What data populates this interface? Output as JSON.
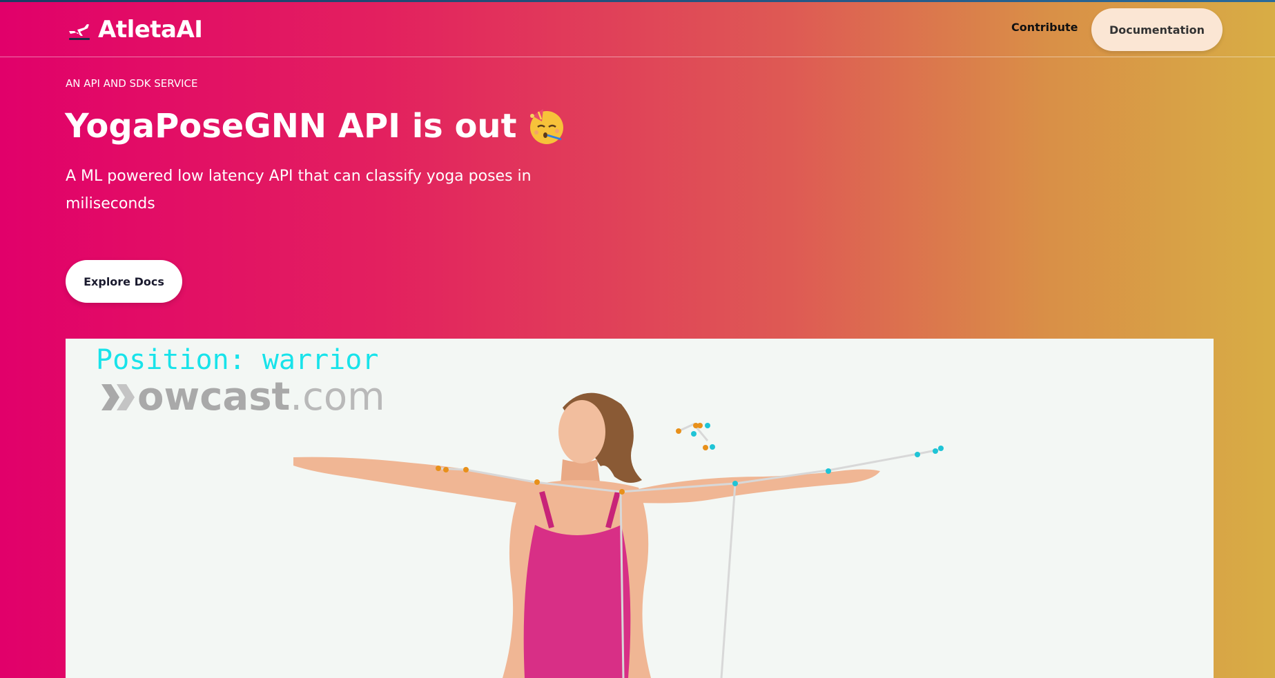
{
  "brand": {
    "name": "AtletaAI",
    "icon": "airplane-takeoff-icon"
  },
  "nav": {
    "contribute": "Contribute",
    "documentation": "Documentation"
  },
  "hero": {
    "eyebrow": "AN API AND SDK SERVICE",
    "title": "YogaPoseGNN API is out",
    "title_emoji": "partying-face-emoji",
    "subtitle": "A ML powered low latency API that can classify yoga poses in miliseconds",
    "cta_label": "Explore Docs"
  },
  "demo": {
    "position_label": "Position:  warrior",
    "watermark_strong": "owcast",
    "watermark_rest": ".com",
    "watermark_icon": "howcast-logo"
  },
  "colors": {
    "gradient_start": "#e1006a",
    "gradient_mid": "#de5a54",
    "gradient_end": "#d8ad45",
    "docs_button_bg": "#fbe6d4",
    "pose_label": "#18e3ea",
    "keypoint_left": "#e8901a",
    "keypoint_right": "#1fc4d6",
    "skeleton_line": "#d8d8d8"
  }
}
